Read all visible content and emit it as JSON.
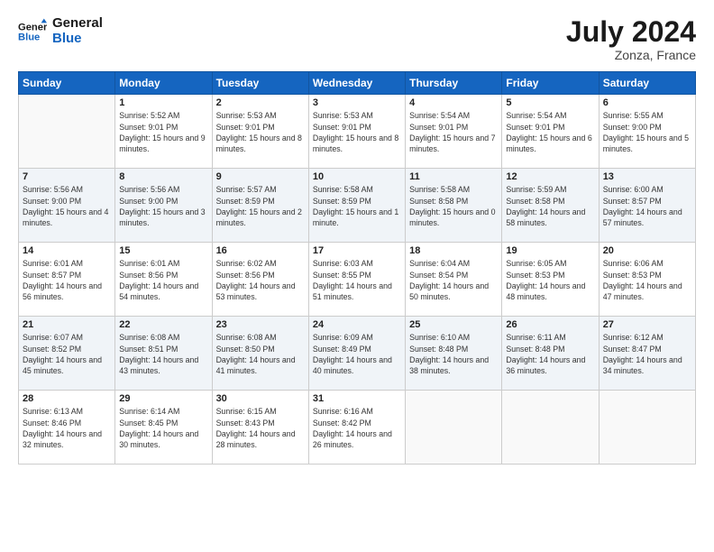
{
  "header": {
    "logo_line1": "General",
    "logo_line2": "Blue",
    "month_year": "July 2024",
    "location": "Zonza, France"
  },
  "weekdays": [
    "Sunday",
    "Monday",
    "Tuesday",
    "Wednesday",
    "Thursday",
    "Friday",
    "Saturday"
  ],
  "weeks": [
    [
      null,
      {
        "day": "1",
        "sunrise": "5:52 AM",
        "sunset": "9:01 PM",
        "daylight": "15 hours and 9 minutes."
      },
      {
        "day": "2",
        "sunrise": "5:53 AM",
        "sunset": "9:01 PM",
        "daylight": "15 hours and 8 minutes."
      },
      {
        "day": "3",
        "sunrise": "5:53 AM",
        "sunset": "9:01 PM",
        "daylight": "15 hours and 8 minutes."
      },
      {
        "day": "4",
        "sunrise": "5:54 AM",
        "sunset": "9:01 PM",
        "daylight": "15 hours and 7 minutes."
      },
      {
        "day": "5",
        "sunrise": "5:54 AM",
        "sunset": "9:01 PM",
        "daylight": "15 hours and 6 minutes."
      },
      {
        "day": "6",
        "sunrise": "5:55 AM",
        "sunset": "9:00 PM",
        "daylight": "15 hours and 5 minutes."
      }
    ],
    [
      {
        "day": "7",
        "sunrise": "5:56 AM",
        "sunset": "9:00 PM",
        "daylight": "15 hours and 4 minutes."
      },
      {
        "day": "8",
        "sunrise": "5:56 AM",
        "sunset": "9:00 PM",
        "daylight": "15 hours and 3 minutes."
      },
      {
        "day": "9",
        "sunrise": "5:57 AM",
        "sunset": "8:59 PM",
        "daylight": "15 hours and 2 minutes."
      },
      {
        "day": "10",
        "sunrise": "5:58 AM",
        "sunset": "8:59 PM",
        "daylight": "15 hours and 1 minute."
      },
      {
        "day": "11",
        "sunrise": "5:58 AM",
        "sunset": "8:58 PM",
        "daylight": "15 hours and 0 minutes."
      },
      {
        "day": "12",
        "sunrise": "5:59 AM",
        "sunset": "8:58 PM",
        "daylight": "14 hours and 58 minutes."
      },
      {
        "day": "13",
        "sunrise": "6:00 AM",
        "sunset": "8:57 PM",
        "daylight": "14 hours and 57 minutes."
      }
    ],
    [
      {
        "day": "14",
        "sunrise": "6:01 AM",
        "sunset": "8:57 PM",
        "daylight": "14 hours and 56 minutes."
      },
      {
        "day": "15",
        "sunrise": "6:01 AM",
        "sunset": "8:56 PM",
        "daylight": "14 hours and 54 minutes."
      },
      {
        "day": "16",
        "sunrise": "6:02 AM",
        "sunset": "8:56 PM",
        "daylight": "14 hours and 53 minutes."
      },
      {
        "day": "17",
        "sunrise": "6:03 AM",
        "sunset": "8:55 PM",
        "daylight": "14 hours and 51 minutes."
      },
      {
        "day": "18",
        "sunrise": "6:04 AM",
        "sunset": "8:54 PM",
        "daylight": "14 hours and 50 minutes."
      },
      {
        "day": "19",
        "sunrise": "6:05 AM",
        "sunset": "8:53 PM",
        "daylight": "14 hours and 48 minutes."
      },
      {
        "day": "20",
        "sunrise": "6:06 AM",
        "sunset": "8:53 PM",
        "daylight": "14 hours and 47 minutes."
      }
    ],
    [
      {
        "day": "21",
        "sunrise": "6:07 AM",
        "sunset": "8:52 PM",
        "daylight": "14 hours and 45 minutes."
      },
      {
        "day": "22",
        "sunrise": "6:08 AM",
        "sunset": "8:51 PM",
        "daylight": "14 hours and 43 minutes."
      },
      {
        "day": "23",
        "sunrise": "6:08 AM",
        "sunset": "8:50 PM",
        "daylight": "14 hours and 41 minutes."
      },
      {
        "day": "24",
        "sunrise": "6:09 AM",
        "sunset": "8:49 PM",
        "daylight": "14 hours and 40 minutes."
      },
      {
        "day": "25",
        "sunrise": "6:10 AM",
        "sunset": "8:48 PM",
        "daylight": "14 hours and 38 minutes."
      },
      {
        "day": "26",
        "sunrise": "6:11 AM",
        "sunset": "8:48 PM",
        "daylight": "14 hours and 36 minutes."
      },
      {
        "day": "27",
        "sunrise": "6:12 AM",
        "sunset": "8:47 PM",
        "daylight": "14 hours and 34 minutes."
      }
    ],
    [
      {
        "day": "28",
        "sunrise": "6:13 AM",
        "sunset": "8:46 PM",
        "daylight": "14 hours and 32 minutes."
      },
      {
        "day": "29",
        "sunrise": "6:14 AM",
        "sunset": "8:45 PM",
        "daylight": "14 hours and 30 minutes."
      },
      {
        "day": "30",
        "sunrise": "6:15 AM",
        "sunset": "8:43 PM",
        "daylight": "14 hours and 28 minutes."
      },
      {
        "day": "31",
        "sunrise": "6:16 AM",
        "sunset": "8:42 PM",
        "daylight": "14 hours and 26 minutes."
      },
      null,
      null,
      null
    ]
  ]
}
